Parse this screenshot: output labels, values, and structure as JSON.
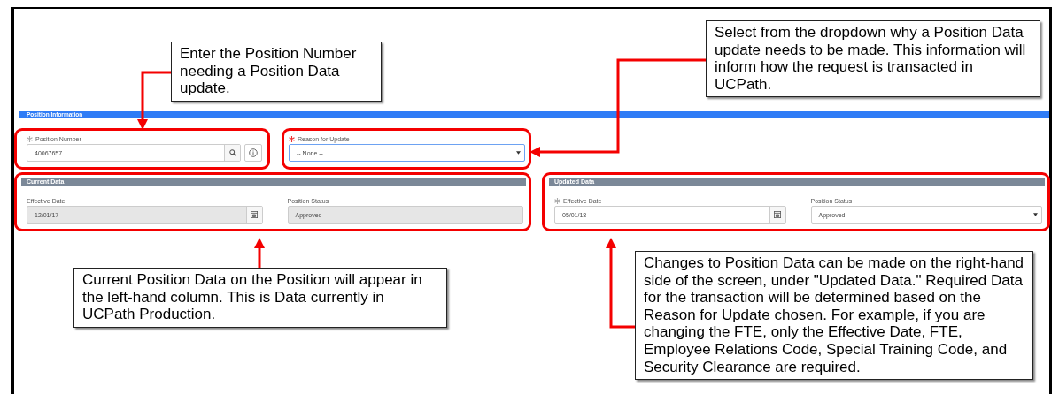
{
  "section_title": "Position Information",
  "position_number": {
    "label": "Position Number",
    "value": "40067657",
    "required": true,
    "error": false
  },
  "reason_for_update": {
    "label": "Reason for Update",
    "value": "-- None --",
    "required": true,
    "error": true,
    "focused": true
  },
  "panels": [
    {
      "title": "Current Data",
      "fields": [
        {
          "kind": "date",
          "label": "Effective Date",
          "value": "12/01/17",
          "required": false,
          "disabled": true
        },
        {
          "kind": "text",
          "label": "Position Status",
          "value": "Approved",
          "required": false,
          "disabled": true
        }
      ]
    },
    {
      "title": "Updated Data",
      "fields": [
        {
          "kind": "date",
          "label": "Effective Date",
          "value": "05/01/18",
          "required": true,
          "disabled": false
        },
        {
          "kind": "select",
          "label": "Position Status",
          "value": "Approved",
          "required": false,
          "disabled": false
        }
      ]
    }
  ],
  "callouts": [
    "Enter the Position Number needing a Position Data update.",
    "Select from the dropdown why a Position Data update needs to be made. This information will inform how the request is transacted in UCPath.",
    "Current Position Data on the Position will appear in the left-hand column. This is Data currently in UCPath Production.",
    "Changes to Position Data can be made on the right-hand side of the screen, under \"Updated Data.\" Required Data for the transaction will be determined based on the Reason for Update chosen. For example, if you are changing the FTE, only the Effective Date, FTE, Employee Relations Code, Special Training Code, and Security Clearance are required."
  ]
}
